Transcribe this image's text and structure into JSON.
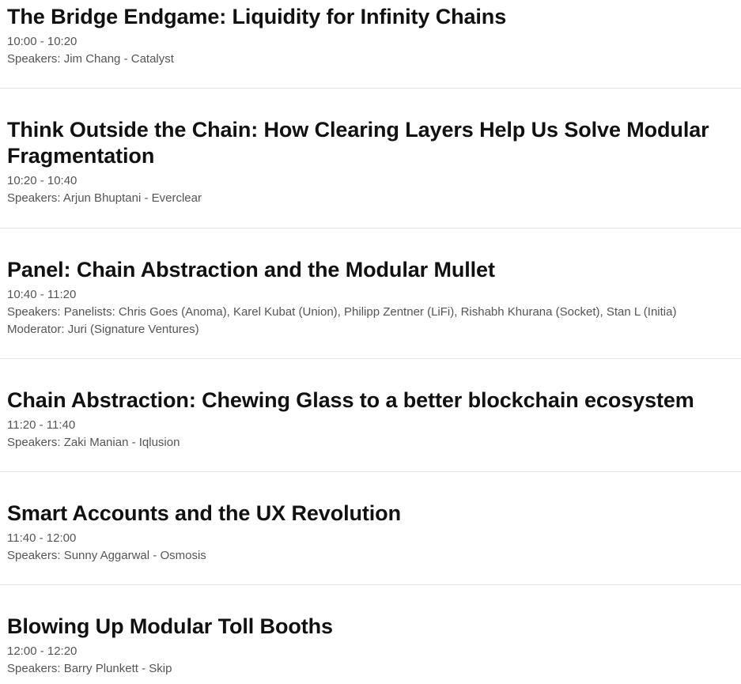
{
  "sessions": [
    {
      "title": "The Bridge Endgame: Liquidity for Infinity Chains",
      "time": "10:00 - 10:20",
      "speakers": "Speakers: Jim Chang - Catalyst"
    },
    {
      "title": "Think Outside the Chain: How Clearing Layers Help Us Solve Modular Fragmentation",
      "time": "10:20 - 10:40",
      "speakers": "Speakers: Arjun Bhuptani - Everclear"
    },
    {
      "title": "Panel: Chain Abstraction and the Modular Mullet",
      "time": "10:40 - 11:20",
      "speakers": "Speakers: Panelists: Chris Goes (Anoma), Karel Kubat (Union), Philipp Zentner (LiFi), Rishabh Khurana (Socket), Stan L (Initia)",
      "moderator": "Moderator: Juri (Signature Ventures)"
    },
    {
      "title": "Chain Abstraction: Chewing Glass to a better blockchain ecosystem",
      "time": "11:20 - 11:40",
      "speakers": "Speakers: Zaki Manian - Iqlusion"
    },
    {
      "title": "Smart Accounts and the UX Revolution",
      "time": "11:40 - 12:00",
      "speakers": "Speakers: Sunny Aggarwal - Osmosis"
    },
    {
      "title": "Blowing Up Modular Toll Booths",
      "time": "12:00 - 12:20",
      "speakers": "Speakers: Barry Plunkett - Skip"
    }
  ]
}
